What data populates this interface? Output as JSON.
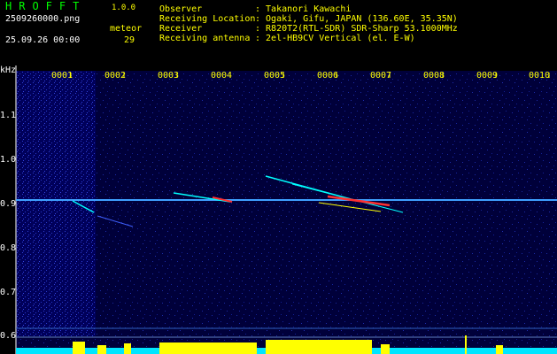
{
  "header": {
    "app_name": "HROFFT",
    "app_version": "1.0.0",
    "file_name": "2509260000.png",
    "datetime": "25.09.26 00:00",
    "meteor_label": "meteor",
    "meteor_count": "29"
  },
  "info": [
    {
      "key": "Observer",
      "value": ": Takanori Kawachi"
    },
    {
      "key": "Receiving Location",
      "value": ": Ogaki, Gifu, JAPAN (136.60E, 35.35N)"
    },
    {
      "key": "Receiver",
      "value": ": R820T2(RTL-SDR) SDR-Sharp 53.1000MHz"
    },
    {
      "key": "Receiving antenna",
      "value": ": 2el-HB9CV Vertical (el. E-W)"
    }
  ],
  "axis": {
    "unit": "kHz",
    "freq_labels": [
      "1.1",
      "1.0",
      "0.9",
      "0.8",
      "0.7",
      "0.6"
    ],
    "minute_labels": [
      "0001",
      "0002",
      "0003",
      "0004",
      "0005",
      "0006",
      "0007",
      "0008",
      "0009",
      "0010"
    ]
  },
  "colors": {
    "background": "#000000",
    "scope_background": "#00003a",
    "header_green": "#00ff00",
    "header_yellow": "#ffff00",
    "carrier_line": "#3fa0ff",
    "echo": "#00ffff",
    "echo_hot": "#ff3030",
    "histogram_bar": "#ffff00",
    "histogram_base": "#00e5ff"
  }
}
